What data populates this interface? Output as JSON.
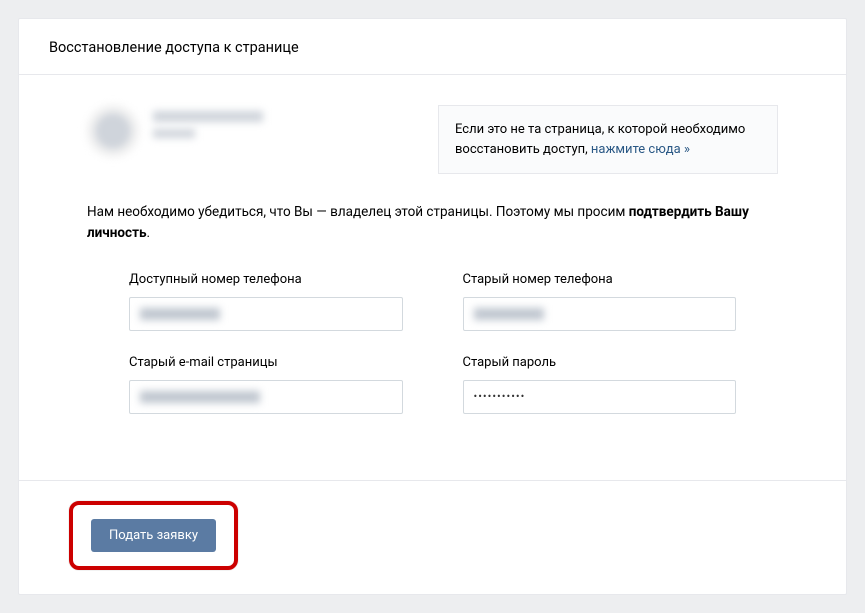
{
  "header": {
    "title": "Восстановление доступа к странице"
  },
  "notice": {
    "text_part1": "Если это не та страница, к которой необходимо восстановить доступ, ",
    "link_text": "нажмите сюда »"
  },
  "instruction": {
    "text_part1": "Нам необходимо убедиться, что Вы — владелец этой страницы. Поэтому мы просим ",
    "bold_part": "подтвердить Вашу личность",
    "text_part2": "."
  },
  "form": {
    "available_phone": {
      "label": "Доступный номер телефона",
      "value": ""
    },
    "old_phone": {
      "label": "Старый номер телефона",
      "value": ""
    },
    "old_email": {
      "label": "Старый e-mail страницы",
      "value": ""
    },
    "old_password": {
      "label": "Старый пароль",
      "value": "•••••••••••"
    }
  },
  "footer": {
    "submit_label": "Подать заявку"
  }
}
